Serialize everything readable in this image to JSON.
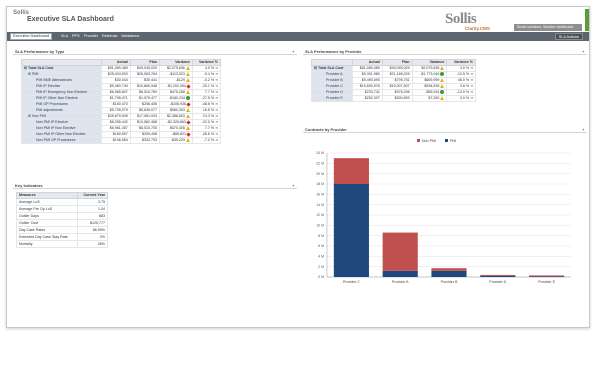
{
  "header": {
    "logo_small": "Sollis",
    "title": "Executive SLA Dashboard",
    "brand": "Sollis",
    "brand_sub": "Clarity.CMS",
    "tagline": "Smart solutions. Smarter healthcare."
  },
  "nav": {
    "tabs": [
      "Executive Dashboard",
      "SLA",
      "PPS",
      "Provider",
      "Referrals",
      "Validations"
    ],
    "actions": "SLA Actions"
  },
  "colors": {
    "red": "#c0504d",
    "blue": "#1f497d",
    "nav": "#5d6670"
  },
  "panel_type": {
    "title": "SLA Performance by Type",
    "columns": [
      "",
      "Actual",
      "Plan",
      "Variance",
      "Variance %"
    ],
    "rows": [
      {
        "label": "Total SLA Cost",
        "actual": "$51,089,489",
        "plan": "$49,045,029",
        "variance": "$2,079,636",
        "pct": "4.0 %",
        "ind": "yellow",
        "total": true
      },
      {
        "label": "PMI",
        "actual": "$25,434,093",
        "plan": "$26,063,764",
        "variance": "-$113,523",
        "pct": "-0.4 %",
        "ind": "yellow"
      },
      {
        "label": "PMI BME Attendances",
        "actual": "$30,044",
        "plan": "$30,441",
        "variance": "-$129",
        "pct": "-0.2 %",
        "ind": "yellow"
      },
      {
        "label": "PMI IP Elective",
        "actual": "$9,460,749",
        "plan": "$10,660,948",
        "variance": "-$1,202,394",
        "pct": "-20.1 %",
        "ind": "red"
      },
      {
        "label": "PMI IP Emergency Non Elective",
        "actual": "$6,985,807",
        "plan": "$6,510,769",
        "variance": "$475,268",
        "pct": "7.7 %",
        "ind": "yellow"
      },
      {
        "label": "PMI IP Other Non Elective",
        "actual": "$1,795,471",
        "plan": "$1,975,477",
        "variance": "-$180,234",
        "pct": "-27.5 %",
        "ind": "green"
      },
      {
        "label": "PMI OP Procedures",
        "actual": "$150,470",
        "plan": "$256,406",
        "variance": "-$106,936",
        "pct": "-48.6 %",
        "ind": "red"
      },
      {
        "label": "PMI adjustments",
        "actual": "$5,735,079",
        "plan": "$5,835,077",
        "variance": "$980,303",
        "pct": "16.5 %",
        "ind": "yellow"
      },
      {
        "label": "Non PMI",
        "actual": "$25,679,939",
        "plan": "$17,961,933",
        "variance": "$2,388,603",
        "pct": "13.3 %",
        "ind": "yellow"
      },
      {
        "label": "Non PMI IP Elective",
        "actual": "$8,255,442",
        "plan": "$10,582,468",
        "variance": "-$2,326,663",
        "pct": "-22.0 %",
        "ind": "red"
      },
      {
        "label": "Non PMI IP Non Elective",
        "actual": "$6,981,457",
        "plan": "$6,510,705",
        "variance": "$470,305",
        "pct": "7.7 %",
        "ind": "yellow"
      },
      {
        "label": "Non PMI IP Other Non Elective",
        "actual": "$169,597",
        "plan": "$259,498",
        "variance": "-$89,821",
        "pct": "-26.6 %",
        "ind": "red"
      },
      {
        "label": "Non PMI OP Procedures",
        "actual": "$196,564",
        "plan": "$332,793",
        "variance": "-$35,229",
        "pct": "-7.2 %",
        "ind": "yellow"
      }
    ]
  },
  "panel_provider": {
    "title": "SLA Performance by Provider",
    "columns": [
      "",
      "Actual",
      "Plan",
      "Variance",
      "Variance %"
    ],
    "rows": [
      {
        "label": "Total SLA Cost",
        "actual": "$51,089,489",
        "plan": "$49,045,029",
        "variance": "$2,079,636",
        "pct": "4.0 %",
        "ind": "yellow",
        "total": true
      },
      {
        "label": "Provider A",
        "actual": "$9,391,980",
        "plan": "$21,165,029",
        "variance": "-$1,773,049",
        "pct": "-10.5 %",
        "ind": "green"
      },
      {
        "label": "Provider B",
        "actual": "$9,490,693",
        "plan": "$799,751",
        "variance": "$669,999",
        "pct": "46.0 %",
        "ind": "yellow"
      },
      {
        "label": "Provider C",
        "actual": "$19,690,976",
        "plan": "$19,007,507",
        "variance": "$934,539",
        "pct": "4.8 %",
        "ind": "yellow"
      },
      {
        "label": "Provider D",
        "actual": "$233,742",
        "plan": "$378,296",
        "variance": "-$55,934",
        "pct": "-12.9 %",
        "ind": "green"
      },
      {
        "label": "Provider E",
        "actual": "$252,307",
        "plan": "$300,893",
        "variance": "$7,260",
        "pct": "3.0 %",
        "ind": "yellow"
      }
    ]
  },
  "panel_kpi": {
    "title": "Key Indicators",
    "columns": [
      "Measures",
      "Current Year"
    ],
    "rows": [
      {
        "label": "Average LoS",
        "value": "3.75"
      },
      {
        "label": "Average Pre Op LoS",
        "value": "1.04"
      },
      {
        "label": "Outlier Days",
        "value": "883"
      },
      {
        "label": "Outlier Cost",
        "value": "$125,777"
      },
      {
        "label": "Day Case Rates",
        "value": "86.99%"
      },
      {
        "label": "Extended Day Case Stay Rate",
        "value": "2%"
      },
      {
        "label": "Mortality",
        "value": "26%"
      }
    ]
  },
  "panel_chart": {
    "title": "Contracts by Provider"
  },
  "chart_data": {
    "type": "bar",
    "stacked": true,
    "categories": [
      "Provider C",
      "Provider A",
      "Provider B",
      "Provider D",
      "Provider E"
    ],
    "series": [
      {
        "name": "Non PMI",
        "color": "#c0504d",
        "values": [
          5.0,
          7.4,
          0.5,
          0.15,
          0.2
        ]
      },
      {
        "name": "PMI",
        "color": "#1f497d",
        "values": [
          18.0,
          1.2,
          1.2,
          0.25,
          0.1
        ]
      }
    ],
    "yticks": [
      "0 M",
      "2 M",
      "4 M",
      "6 M",
      "8 M",
      "10 M",
      "12 M",
      "14 M",
      "16 M",
      "18 M",
      "20 M",
      "22 M",
      "24 M"
    ],
    "ylim": [
      0,
      24
    ],
    "legend_position": "top-center"
  }
}
